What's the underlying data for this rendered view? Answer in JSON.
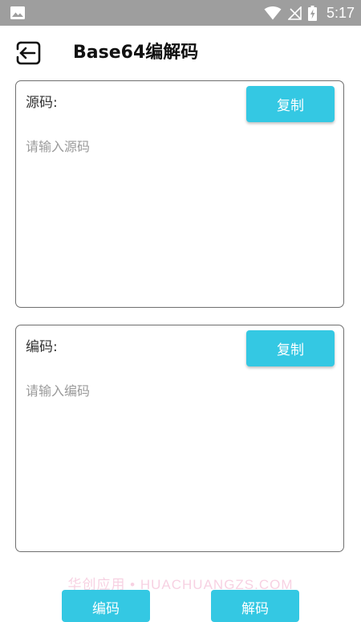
{
  "status_bar": {
    "time": "5:17",
    "icons": [
      "image-icon",
      "wifi-icon",
      "no-signal-icon",
      "battery-charging-icon"
    ]
  },
  "header": {
    "title": "Base64编解码",
    "back_icon": "exit-icon"
  },
  "source_panel": {
    "label": "源码:",
    "copy_label": "复制",
    "placeholder": "请输入源码",
    "value": ""
  },
  "encoded_panel": {
    "label": "编码:",
    "copy_label": "复制",
    "placeholder": "请输入编码",
    "value": ""
  },
  "actions": {
    "encode_label": "编码",
    "decode_label": "解码"
  },
  "watermark": "华创应用 • HUACHUANGZS.COM",
  "colors": {
    "accent": "#34c8e3",
    "status_bar": "#9e9e9e",
    "border": "#6f6f6f"
  }
}
